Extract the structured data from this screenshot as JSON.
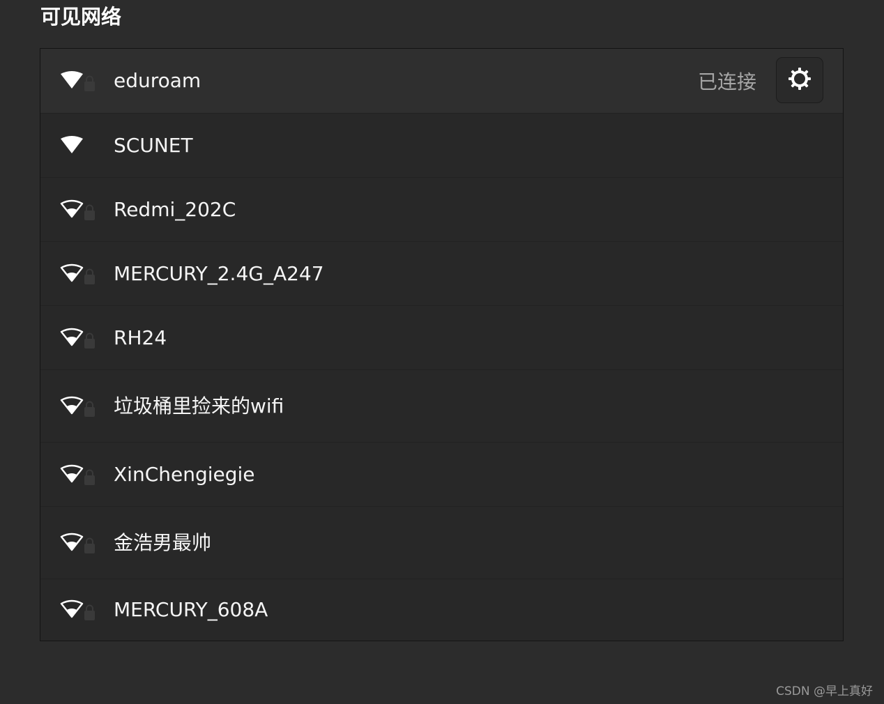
{
  "section": {
    "title": "可见网络"
  },
  "networks": [
    {
      "name": "eduroam",
      "status": "已连接",
      "signal": "full",
      "secured": true,
      "icon": "wifi-signal-full-icon"
    },
    {
      "name": " SCUNET",
      "signal": "full",
      "secured": false,
      "icon": "wifi-signal-full-icon"
    },
    {
      "name": "Redmi_202C",
      "signal": "weak",
      "secured": true,
      "icon": "wifi-signal-weak-icon"
    },
    {
      "name": "MERCURY_2.4G_A247",
      "signal": "weak",
      "secured": true,
      "icon": "wifi-signal-weak-icon"
    },
    {
      "name": "RH24",
      "signal": "weak",
      "secured": true,
      "icon": "wifi-signal-weak-icon"
    },
    {
      "name": "垃圾桶里捡来的wifi",
      "signal": "weak",
      "secured": true,
      "icon": "wifi-signal-weak-icon"
    },
    {
      "name": "XinChengiegie",
      "signal": "weak",
      "secured": true,
      "icon": "wifi-signal-weak-icon"
    },
    {
      "name": "金浩男最帅",
      "signal": "weak",
      "secured": true,
      "icon": "wifi-signal-weak-icon"
    },
    {
      "name": "MERCURY_608A",
      "signal": "weak",
      "secured": true,
      "icon": "wifi-signal-weak-icon"
    }
  ],
  "settings_button": {
    "icon": "gear-icon"
  },
  "watermark": "CSDN @早上真好",
  "colors": {
    "background": "#2c2c2c",
    "list_background": "#282828",
    "connected_row": "#2f2f2f",
    "status_text": "#a6a6a6"
  }
}
